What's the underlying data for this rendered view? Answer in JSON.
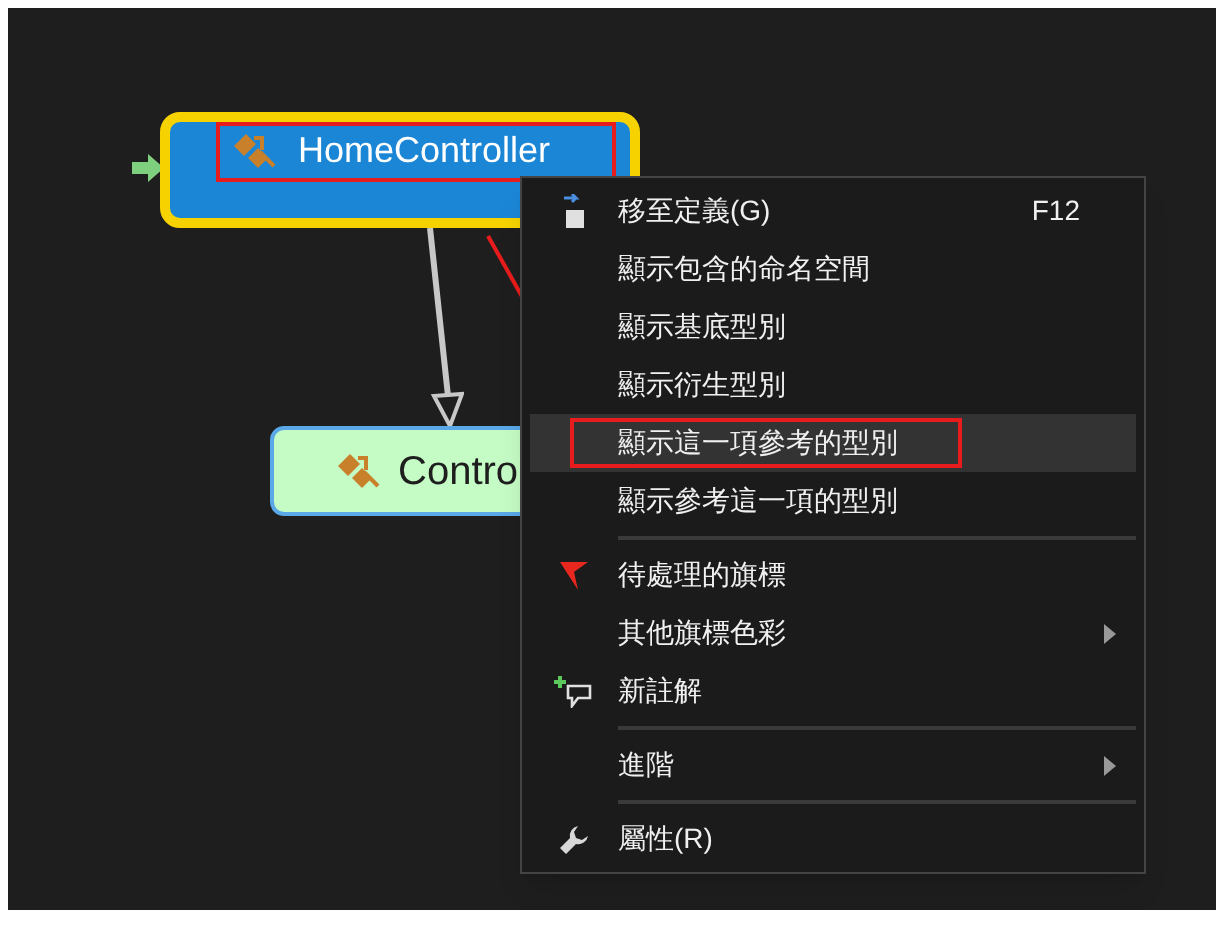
{
  "nodes": [
    {
      "label": "HomeController",
      "selected": true
    },
    {
      "label": "Contro",
      "selected": false
    }
  ],
  "context_menu": {
    "items": [
      {
        "kind": "item",
        "label": "移至定義(G)",
        "shortcut": "F12",
        "submenu": false,
        "selected": false
      },
      {
        "kind": "item",
        "label": "顯示包含的命名空間",
        "submenu": false,
        "selected": false
      },
      {
        "kind": "item",
        "label": "顯示基底型別",
        "submenu": false,
        "selected": false
      },
      {
        "kind": "item",
        "label": "顯示衍生型別",
        "submenu": false,
        "selected": false
      },
      {
        "kind": "item",
        "label": "顯示這一項參考的型別",
        "submenu": false,
        "selected": true
      },
      {
        "kind": "item",
        "label": "顯示參考這一項的型別",
        "submenu": false,
        "selected": false
      },
      {
        "kind": "separator"
      },
      {
        "kind": "item",
        "label": "待處理的旗標",
        "submenu": false,
        "selected": false
      },
      {
        "kind": "item",
        "label": "其他旗標色彩",
        "submenu": true,
        "selected": false
      },
      {
        "kind": "item",
        "label": "新註解",
        "submenu": false,
        "selected": false
      },
      {
        "kind": "separator"
      },
      {
        "kind": "item",
        "label": "進階",
        "submenu": true,
        "selected": false
      },
      {
        "kind": "separator"
      },
      {
        "kind": "item",
        "label": "屬性(R)",
        "submenu": false,
        "selected": false
      }
    ]
  }
}
